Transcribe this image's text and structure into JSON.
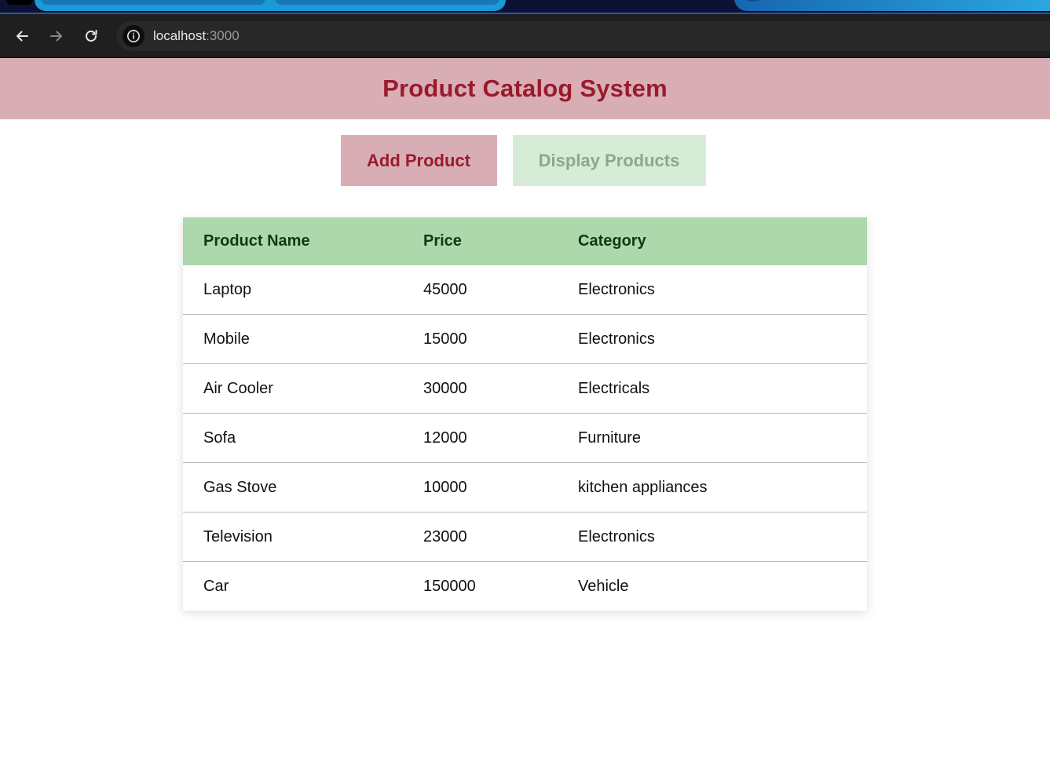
{
  "browser": {
    "url_host": "localhost",
    "url_port": ":3000",
    "icons": {
      "back": "arrow-left-icon",
      "forward": "arrow-right-icon",
      "reload": "reload-icon",
      "site_info": "info-icon"
    }
  },
  "header": {
    "title": "Product Catalog System"
  },
  "actions": {
    "add_label": "Add Product",
    "display_label": "Display Products"
  },
  "table": {
    "columns": [
      "Product Name",
      "Price",
      "Category"
    ],
    "rows": [
      [
        "Laptop",
        "45000",
        "Electronics"
      ],
      [
        "Mobile",
        "15000",
        "Electronics"
      ],
      [
        "Air Cooler",
        "30000",
        "Electricals"
      ],
      [
        "Sofa",
        "12000",
        "Furniture"
      ],
      [
        "Gas Stove",
        "10000",
        "kitchen appliances"
      ],
      [
        "Television",
        "23000",
        "Electronics"
      ],
      [
        "Car",
        "150000",
        "Vehicle"
      ]
    ]
  },
  "colors": {
    "header_bg": "#d8aeb4",
    "accent_red": "#9a1a2e",
    "table_header_bg": "#acd8ab",
    "display_button_bg": "#d6ecd6"
  }
}
